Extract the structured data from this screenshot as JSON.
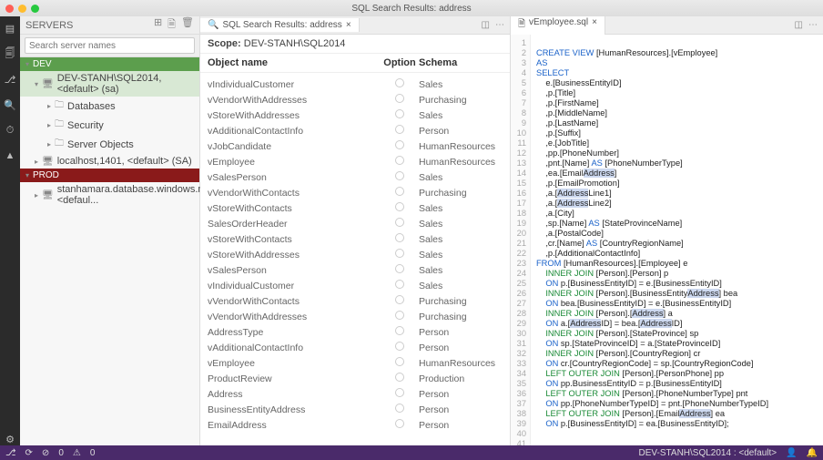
{
  "window": {
    "title": "SQL Search Results: address"
  },
  "serverpanel": {
    "heading": "SERVERS",
    "search_placeholder": "Search server names",
    "groups": {
      "dev": "DEV",
      "prod": "PROD"
    },
    "nodes": {
      "dev_server": "DEV-STANH\\SQL2014, <default> (sa)",
      "databases": "Databases",
      "security": "Security",
      "server_objects": "Server Objects",
      "localhost": "localhost,1401, <default> (SA)",
      "prod_server": "stanhamara.database.windows.net, <defaul..."
    }
  },
  "search_tab": {
    "label": "SQL Search Results: address",
    "scope_label": "Scope:",
    "scope_value": "DEV-STANH\\SQL2014",
    "columns": {
      "name": "Object name",
      "option": "Option",
      "schema": "Schema"
    },
    "rows": [
      {
        "name": "vIndividualCustomer",
        "schema": "Sales"
      },
      {
        "name": "vVendorWithAddresses",
        "schema": "Purchasing"
      },
      {
        "name": "vStoreWithAddresses",
        "schema": "Sales"
      },
      {
        "name": "vAdditionalContactInfo",
        "schema": "Person"
      },
      {
        "name": "vJobCandidate",
        "schema": "HumanResources"
      },
      {
        "name": "vEmployee",
        "schema": "HumanResources"
      },
      {
        "name": "vSalesPerson",
        "schema": "Sales"
      },
      {
        "name": "vVendorWithContacts",
        "schema": "Purchasing"
      },
      {
        "name": "vStoreWithContacts",
        "schema": "Sales"
      },
      {
        "name": "SalesOrderHeader",
        "schema": "Sales"
      },
      {
        "name": "vStoreWithContacts",
        "schema": "Sales"
      },
      {
        "name": "vStoreWithAddresses",
        "schema": "Sales"
      },
      {
        "name": "vSalesPerson",
        "schema": "Sales"
      },
      {
        "name": "vIndividualCustomer",
        "schema": "Sales"
      },
      {
        "name": "vVendorWithContacts",
        "schema": "Purchasing"
      },
      {
        "name": "vVendorWithAddresses",
        "schema": "Purchasing"
      },
      {
        "name": "AddressType",
        "schema": "Person"
      },
      {
        "name": "vAdditionalContactInfo",
        "schema": "Person"
      },
      {
        "name": "vEmployee",
        "schema": "HumanResources"
      },
      {
        "name": "ProductReview",
        "schema": "Production"
      },
      {
        "name": "Address",
        "schema": "Person"
      },
      {
        "name": "BusinessEntityAddress",
        "schema": "Person"
      },
      {
        "name": "EmailAddress",
        "schema": "Person"
      }
    ]
  },
  "editor_tab": {
    "label": "vEmployee.sql"
  },
  "code": {
    "lines": [
      {
        "n": 1,
        "t": ""
      },
      {
        "n": 2,
        "t": "<kw>CREATE VIEW</kw> [HumanResources].[vEmployee]"
      },
      {
        "n": 3,
        "t": "<kw>AS</kw>"
      },
      {
        "n": 4,
        "t": "<kw>SELECT</kw>"
      },
      {
        "n": 5,
        "t": "    e.[BusinessEntityID]"
      },
      {
        "n": 6,
        "t": "    ,p.[Title]"
      },
      {
        "n": 7,
        "t": "    ,p.[FirstName]"
      },
      {
        "n": 8,
        "t": "    ,p.[MiddleName]"
      },
      {
        "n": 9,
        "t": "    ,p.[LastName]"
      },
      {
        "n": 10,
        "t": "    ,p.[Suffix]"
      },
      {
        "n": 11,
        "t": "    ,e.[JobTitle]"
      },
      {
        "n": 12,
        "t": "    ,pp.[PhoneNumber]"
      },
      {
        "n": 13,
        "t": "    ,pnt.[Name] <kw>AS</kw> [PhoneNumberType]"
      },
      {
        "n": 14,
        "t": "    ,ea.[Email<hl>Address</hl>]"
      },
      {
        "n": 15,
        "t": "    ,p.[EmailPromotion]"
      },
      {
        "n": 16,
        "t": "    ,a.[<hl>Address</hl>Line1]"
      },
      {
        "n": 17,
        "t": "    ,a.[<hl>Address</hl>Line2]"
      },
      {
        "n": 18,
        "t": "    ,a.[City]"
      },
      {
        "n": 19,
        "t": "    ,sp.[Name] <kw>AS</kw> [StateProvinceName]"
      },
      {
        "n": 20,
        "t": "    ,a.[PostalCode]"
      },
      {
        "n": 21,
        "t": "    ,cr.[Name] <kw>AS</kw> [CountryRegionName]"
      },
      {
        "n": 22,
        "t": "    ,p.[AdditionalContactInfo]"
      },
      {
        "n": 23,
        "t": "<kw>FROM</kw> [HumanResources].[Employee] e"
      },
      {
        "n": 24,
        "t": "    <typ>INNER JOIN</typ> [Person].[Person] p"
      },
      {
        "n": 25,
        "t": "    <kw>ON</kw> p.[BusinessEntityID] = e.[BusinessEntityID]"
      },
      {
        "n": 26,
        "t": "    <typ>INNER JOIN</typ> [Person].[BusinessEntity<hl>Address</hl>] bea"
      },
      {
        "n": 27,
        "t": "    <kw>ON</kw> bea.[BusinessEntityID] = e.[BusinessEntityID]"
      },
      {
        "n": 28,
        "t": "    <typ>INNER JOIN</typ> [Person].[<hl>Address</hl>] a"
      },
      {
        "n": 29,
        "t": "    <kw>ON</kw> a.[<hl>Address</hl>ID] = bea.[<hl>Address</hl>ID]"
      },
      {
        "n": 30,
        "t": "    <typ>INNER JOIN</typ> [Person].[StateProvince] sp"
      },
      {
        "n": 31,
        "t": "    <kw>ON</kw> sp.[StateProvinceID] = a.[StateProvinceID]"
      },
      {
        "n": 32,
        "t": "    <typ>INNER JOIN</typ> [Person].[CountryRegion] cr"
      },
      {
        "n": 33,
        "t": "    <kw>ON</kw> cr.[CountryRegionCode] = sp.[CountryRegionCode]"
      },
      {
        "n": 34,
        "t": "    <typ>LEFT OUTER JOIN</typ> [Person].[PersonPhone] pp"
      },
      {
        "n": 35,
        "t": "    <kw>ON</kw> pp.BusinessEntityID = p.[BusinessEntityID]"
      },
      {
        "n": 36,
        "t": "    <typ>LEFT OUTER JOIN</typ> [Person].[PhoneNumberType] pnt"
      },
      {
        "n": 37,
        "t": "    <kw>ON</kw> pp.[PhoneNumberTypeID] = pnt.[PhoneNumberTypeID]"
      },
      {
        "n": 38,
        "t": "    <typ>LEFT OUTER JOIN</typ> [Person].[Email<hl>Address</hl>] ea"
      },
      {
        "n": 39,
        "t": "    <kw>ON</kw> p.[BusinessEntityID] = ea.[BusinessEntityID];"
      },
      {
        "n": 40,
        "t": ""
      },
      {
        "n": 41,
        "t": ""
      }
    ]
  },
  "statusbar": {
    "connection": "DEV-STANH\\SQL2014 : <default>",
    "issues": "0",
    "icons": {
      "git": "⎇",
      "sync": "⟳",
      "err": "⊘",
      "warn": "⚠",
      "bell": "🔔",
      "user": "👤"
    }
  }
}
